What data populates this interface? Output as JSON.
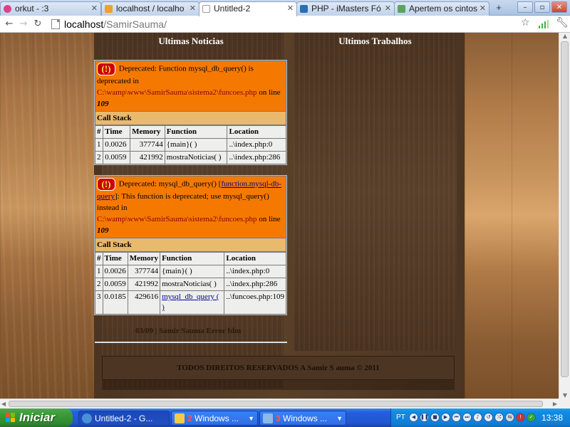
{
  "browser": {
    "tabs": [
      {
        "title": "orkut - :3",
        "favicon_color": "#e03f8c"
      },
      {
        "title": "localhost / localho",
        "favicon_color": "#f0a030"
      },
      {
        "title": "Untitled-2",
        "favicon_color": "#c0c0c0",
        "active": true
      },
      {
        "title": "PHP - iMasters Fó",
        "favicon_color": "#2a6fb3"
      },
      {
        "title": "Apertem os cintos",
        "favicon_color": "#5aa55a"
      }
    ],
    "new_tab_label": "+",
    "window_buttons": [
      "–",
      "▫",
      "✕"
    ],
    "url_host": "localhost",
    "url_path": "/SamirSauma/"
  },
  "page": {
    "news_title": "Ultimas Noticias",
    "works_title": "Ultimos Trabalhos",
    "errors": [
      {
        "bang": "(!)",
        "message_parts": {
          "lead": "Deprecated: Function mysql_db_query() is deprecated in",
          "file": "C:\\wamp\\www\\SamirSauma\\sistema2\\funcoes.php",
          "on_line": "on line",
          "line": "109"
        },
        "callstack_label": "Call Stack",
        "columns": [
          "#",
          "Time",
          "Memory",
          "Function",
          "Location"
        ],
        "rows": [
          [
            "1",
            "0.0026",
            "377744",
            "{main}( )",
            "..\\index.php:0"
          ],
          [
            "2",
            "0.0059",
            "421992",
            "mostraNoticias( )",
            "..\\index.php:286"
          ]
        ]
      },
      {
        "bang": "(!)",
        "message_parts": {
          "lead": "Deprecated: mysql_db_query()",
          "link": "function.mysql-db-query",
          "rest": ": This function is deprecated; use mysql_query() instead in",
          "file": "C:\\wamp\\www\\SamirSauma\\sistema2\\funcoes.php",
          "on_line": "on line",
          "line": "109"
        },
        "callstack_label": "Call Stack",
        "columns": [
          "#",
          "Time",
          "Memory",
          "Function",
          "Location"
        ],
        "rows": [
          [
            "1",
            "0.0026",
            "377744",
            "{main}( )",
            "..\\index.php:0"
          ],
          [
            "2",
            "0.0059",
            "421992",
            "mostraNoticias( )",
            "..\\index.php:286"
          ],
          [
            "3",
            "0.0185",
            "429616",
            "mysql_db_query ( )",
            "..\\funcoes.php:109"
          ]
        ]
      }
    ],
    "credit": "03/09 | Samir Sauma Error fdm",
    "footer": "TODOS DIREITOS RESERVADOS A Samir S auma © 2011"
  },
  "taskbar": {
    "start_label": "Iniciar",
    "tasks": [
      {
        "label": "Untitled-2 - G...",
        "icon_color": "#4a90d9",
        "active": true
      },
      {
        "count": "2",
        "label": " Windows ...",
        "icon_color": "#f3c94a"
      },
      {
        "count": "3",
        "label": " Windows ...",
        "icon_color": "#8db8e8"
      }
    ],
    "language": "PT",
    "clock": "13:38"
  }
}
